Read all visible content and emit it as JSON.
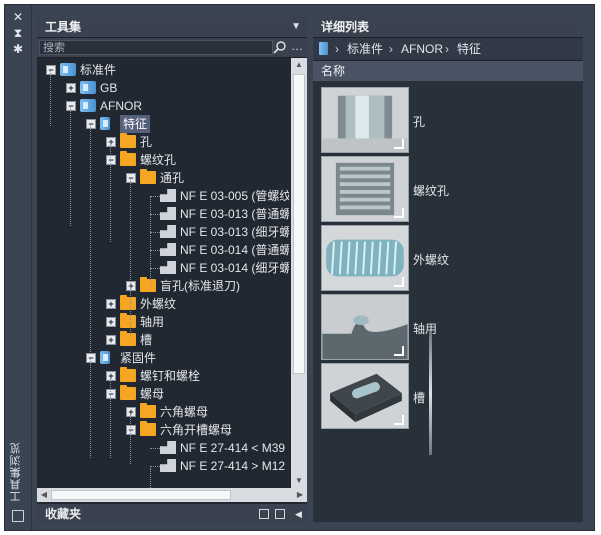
{
  "sidebar_title": "工具集浏览",
  "left_panel": {
    "title": "工具集",
    "search_placeholder": "搜索",
    "favorites_label": "收藏夹"
  },
  "tree": [
    {
      "label": "标准件",
      "icon": "library-icon",
      "toggle": "-",
      "level": 0
    },
    {
      "label": "GB",
      "icon": "library-icon",
      "toggle": "+",
      "level": 1
    },
    {
      "label": "AFNOR",
      "icon": "library-icon",
      "toggle": "-",
      "level": 1
    },
    {
      "label": "特征",
      "icon": "book-icon",
      "toggle": "-",
      "level": 2,
      "selected": true
    },
    {
      "label": "孔",
      "icon": "folder-icon",
      "toggle": "+",
      "level": 3
    },
    {
      "label": "螺纹孔",
      "icon": "folder-icon",
      "toggle": "-",
      "level": 3
    },
    {
      "label": "通孔",
      "icon": "folder-icon",
      "toggle": "-",
      "level": 4
    },
    {
      "label": "NF E 03-005 (管螺纹",
      "icon": "part-icon",
      "level": 5
    },
    {
      "label": "NF E 03-013 (普通螺",
      "icon": "part-icon",
      "level": 5
    },
    {
      "label": "NF E 03-013 (细牙螺",
      "icon": "part-icon",
      "level": 5
    },
    {
      "label": "NF E 03-014 (普通螺",
      "icon": "part-icon",
      "level": 5
    },
    {
      "label": "NF E 03-014 (细牙螺",
      "icon": "part-icon",
      "level": 5
    },
    {
      "label": "盲孔(标准退刀)",
      "icon": "folder-icon",
      "toggle": "+",
      "level": 4
    },
    {
      "label": "外螺纹",
      "icon": "folder-icon",
      "toggle": "+",
      "level": 3
    },
    {
      "label": "轴用",
      "icon": "folder-icon",
      "toggle": "+",
      "level": 3
    },
    {
      "label": "槽",
      "icon": "folder-icon",
      "toggle": "+",
      "level": 3
    },
    {
      "label": "紧固件",
      "icon": "book-icon",
      "toggle": "-",
      "level": 2
    },
    {
      "label": "螺钉和螺栓",
      "icon": "folder-icon",
      "toggle": "+",
      "level": 3
    },
    {
      "label": "螺母",
      "icon": "folder-icon",
      "toggle": "-",
      "level": 3
    },
    {
      "label": "六角螺母",
      "icon": "folder-icon",
      "toggle": "+",
      "level": 4
    },
    {
      "label": "六角开槽螺母",
      "icon": "folder-icon",
      "toggle": "-",
      "level": 4
    },
    {
      "label": "NF E 27-414 < M39",
      "icon": "part-icon",
      "level": 5
    },
    {
      "label": "NF E 27-414 > M12",
      "icon": "part-icon",
      "level": 5
    }
  ],
  "right_panel": {
    "title": "详细列表",
    "breadcrumb": [
      "标准件",
      "AFNOR",
      "特征"
    ],
    "column_header": "名称",
    "items": [
      {
        "label": "孔",
        "icon": "hole-thumbnail"
      },
      {
        "label": "螺纹孔",
        "icon": "threaded-hole-thumbnail"
      },
      {
        "label": "外螺纹",
        "icon": "external-thread-thumbnail"
      },
      {
        "label": "轴用",
        "icon": "shaft-groove-thumbnail"
      },
      {
        "label": "槽",
        "icon": "slot-thumbnail"
      }
    ]
  }
}
